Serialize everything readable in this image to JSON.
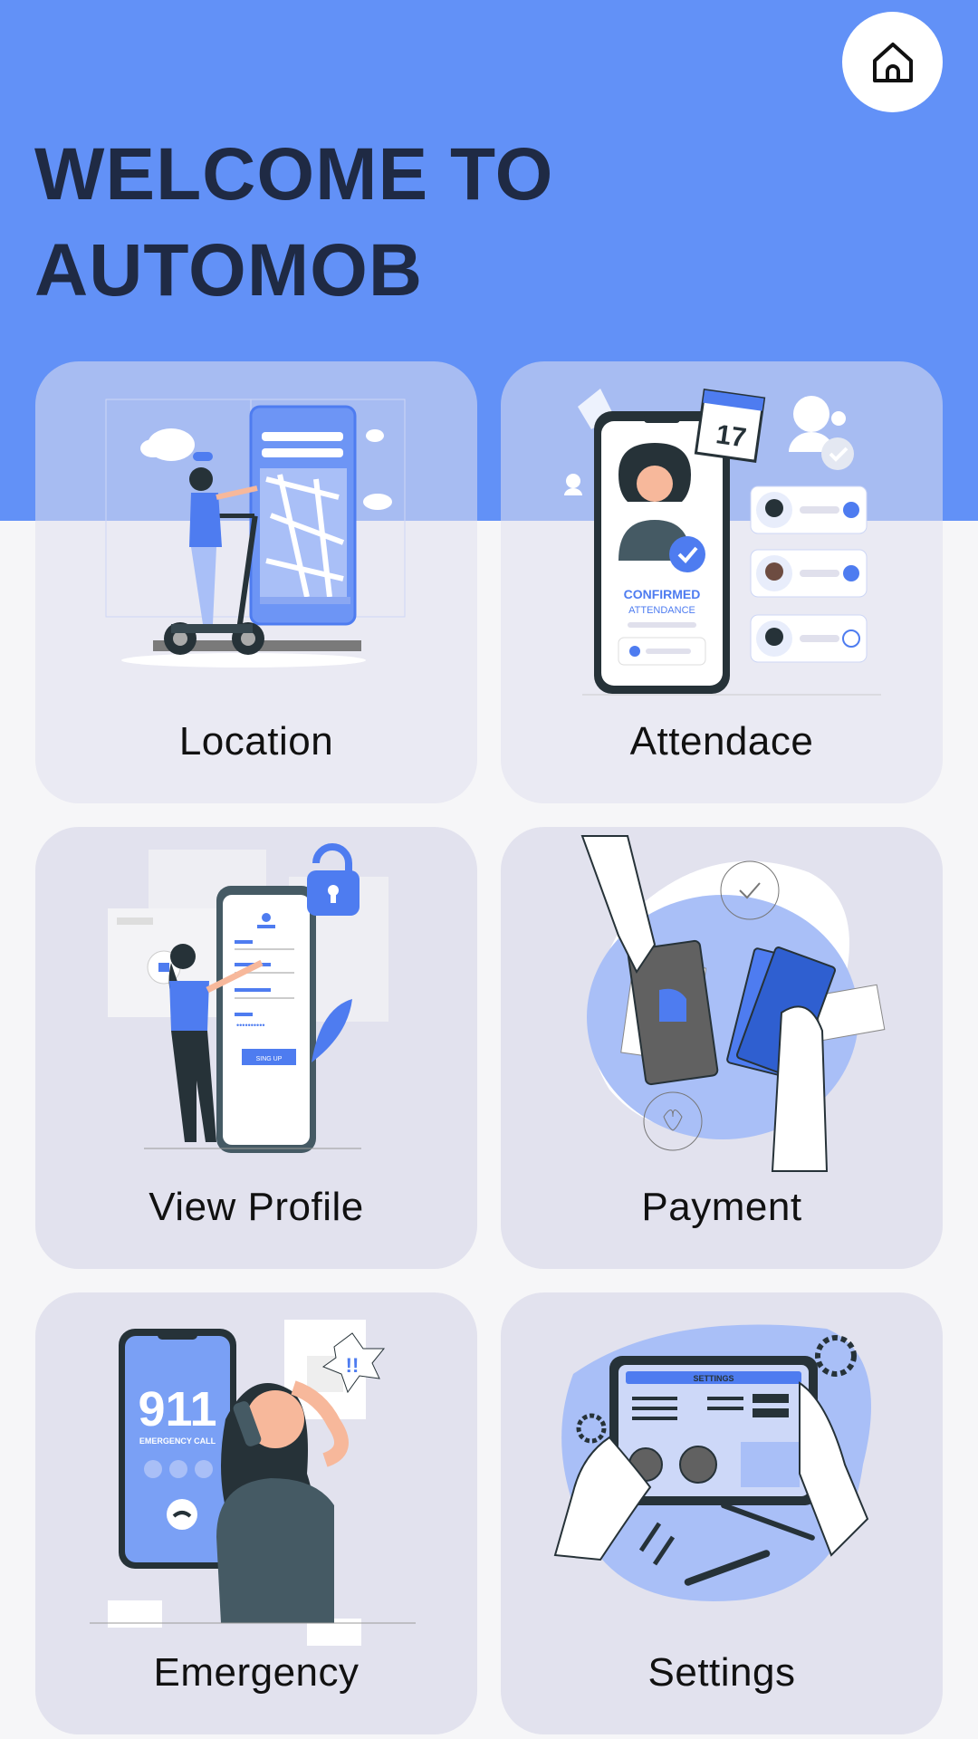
{
  "header": {
    "title_line1": "WELCOME TO",
    "title_line2": "AUTOMOB",
    "home_icon": "home-icon",
    "background_color": "#6291f7"
  },
  "menu": {
    "items": [
      {
        "label": "Location",
        "icon": "scooter-map-illustration"
      },
      {
        "label": "Attendace",
        "icon": "confirmed-attendance-illustration"
      },
      {
        "label": "View Profile",
        "icon": "signup-profile-illustration"
      },
      {
        "label": "Payment",
        "icon": "payment-hands-illustration"
      },
      {
        "label": "Emergency",
        "icon": "emergency-call-illustration"
      },
      {
        "label": "Settings",
        "icon": "settings-tablet-illustration"
      }
    ]
  },
  "illustration_text": {
    "calendar_day": "17",
    "confirmed": "CONFIRMED",
    "attendance": "ATTENDANCE",
    "signup": "SING UP",
    "emergency_number": "911",
    "emergency_call": "EMERGENCY CALL",
    "alert": "!!",
    "settings_bar": "SETTINGS"
  },
  "colors": {
    "accent": "#4e7cf0",
    "dark": "#263238",
    "card": "#e0e0ec"
  }
}
